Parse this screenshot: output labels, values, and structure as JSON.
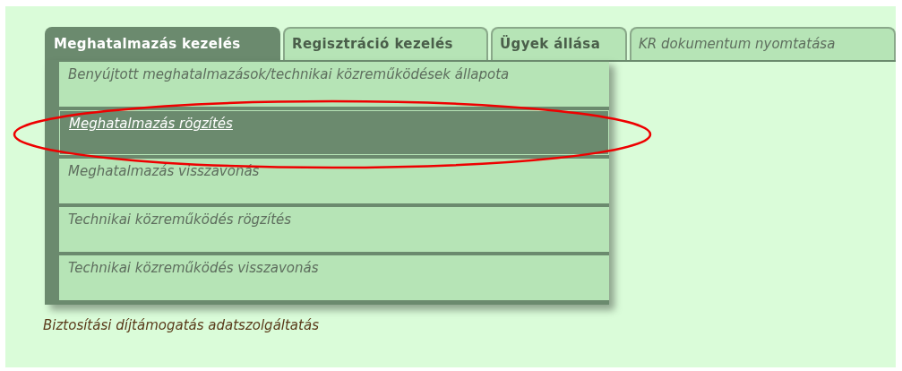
{
  "tabs": [
    {
      "label": "Meghatalmazás kezelés",
      "selected": true,
      "disabled": false
    },
    {
      "label": "Regisztráció kezelés",
      "selected": false,
      "disabled": false
    },
    {
      "label": "Ügyek állása",
      "selected": false,
      "disabled": false
    },
    {
      "label": "KR dokumentum nyomtatása",
      "selected": false,
      "disabled": true
    }
  ],
  "menu_items": [
    {
      "label": "Benyújtott meghatalmazások/technikai közreműködések állapota",
      "selected": false
    },
    {
      "label": "Meghatalmazás rögzítés",
      "selected": true
    },
    {
      "label": "Meghatalmazás visszavonás",
      "selected": false
    },
    {
      "label": "Technikai közreműködés rögzítés",
      "selected": false
    },
    {
      "label": "Technikai közreműködés visszavonás",
      "selected": false
    }
  ],
  "links": [
    "Biztosítási díjtámogatás adatszolgáltatás"
  ]
}
